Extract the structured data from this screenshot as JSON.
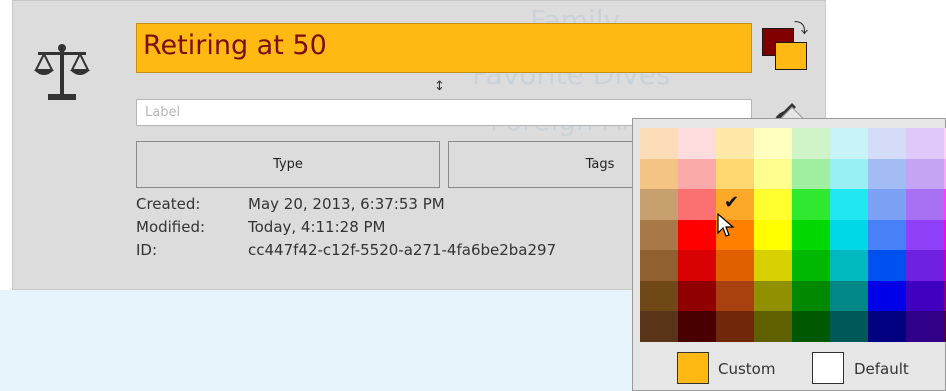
{
  "title": "Retiring at 50",
  "label_placeholder": "Label",
  "buttons": {
    "type": "Type",
    "tags": "Tags"
  },
  "background_map": [
    "Family",
    "Favorite Dives",
    "Foreign Af"
  ],
  "meta": [
    {
      "key": "Created:",
      "value": "May 20, 2013, 6:37:53 PM"
    },
    {
      "key": "Modified:",
      "value": "Today, 4:11:28 PM"
    },
    {
      "key": "ID:",
      "value": "cc447f42-c12f-5520-a271-4fa6be2ba297"
    }
  ],
  "colors": {
    "fill": "#ffb912",
    "text": "#800000",
    "panel": "#dcdcdc",
    "lower_background": "#e8f4fc"
  },
  "palette": {
    "selected": {
      "row": 2,
      "col": 2
    },
    "rows": [
      [
        "#fddcb8",
        "#fcdcdc",
        "#fde8a8",
        "#ffffc0",
        "#d0f4c8",
        "#c8f4f8",
        "#d4dcf8",
        "#e0c8f8",
        "#fcd4f8"
      ],
      [
        "#f4c484",
        "#fbaaaa",
        "#fdd870",
        "#ffff90",
        "#a0eea0",
        "#98f0f4",
        "#a4bcf4",
        "#c4a4f4",
        "#f8a8f4"
      ],
      [
        "#c8a070",
        "#fb7070",
        "#fca828",
        "#ffff30",
        "#30e830",
        "#20e8f0",
        "#7ca0f4",
        "#a870f4",
        "#f840f4"
      ],
      [
        "#a87848",
        "#ff0000",
        "#ff8000",
        "#ffff00",
        "#00d800",
        "#00d8e8",
        "#4880f8",
        "#9040f8",
        "#e810e0"
      ],
      [
        "#906030",
        "#d80000",
        "#e06000",
        "#d8d000",
        "#00b800",
        "#00b8c0",
        "#0050f0",
        "#7020e0",
        "#c000c0"
      ],
      [
        "#704818",
        "#900000",
        "#a84010",
        "#909000",
        "#008800",
        "#008888",
        "#0000e8",
        "#4000c0",
        "#800080"
      ],
      [
        "#5a3418",
        "#480000",
        "#702808",
        "#606000",
        "#005800",
        "#005858",
        "#000080",
        "#300088",
        "#480048"
      ]
    ]
  },
  "custom_label": "Custom",
  "default_label": "Default",
  "icons": [
    "scale-icon",
    "color-swap-icon",
    "brush-icon",
    "resize-grip-icon",
    "checkmark-icon",
    "pointer-cursor-icon"
  ]
}
